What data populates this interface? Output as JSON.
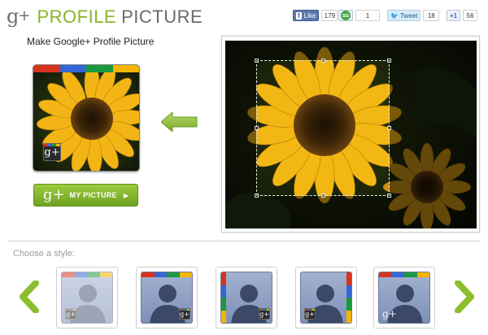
{
  "header": {
    "logo_g": "g",
    "logo_plus": "+",
    "logo_word1": "PROFILE",
    "logo_word2": "PICTURE"
  },
  "share": {
    "facebook": {
      "icon": "f",
      "label": "Like",
      "count": "179"
    },
    "stumbleupon": {
      "icon": "su",
      "count": "1"
    },
    "twitter": {
      "icon": "bird-icon",
      "label": "Tweet",
      "count": "18"
    },
    "googleplus": {
      "label": "+1",
      "count": "56"
    }
  },
  "left": {
    "subtitle": "Make Google+ Profile Picture",
    "badge_text": "g+",
    "button": {
      "g": "g+",
      "label": "MY PICTURE",
      "arrow": "▶"
    }
  },
  "styles": {
    "label": "Choose a style:",
    "badge_text": "g+"
  },
  "colors": {
    "brand_green": "#8ab428",
    "google_red": "#d7331f",
    "google_blue": "#3367d6",
    "google_green": "#1a9a3e",
    "google_yellow": "#f5b400"
  }
}
